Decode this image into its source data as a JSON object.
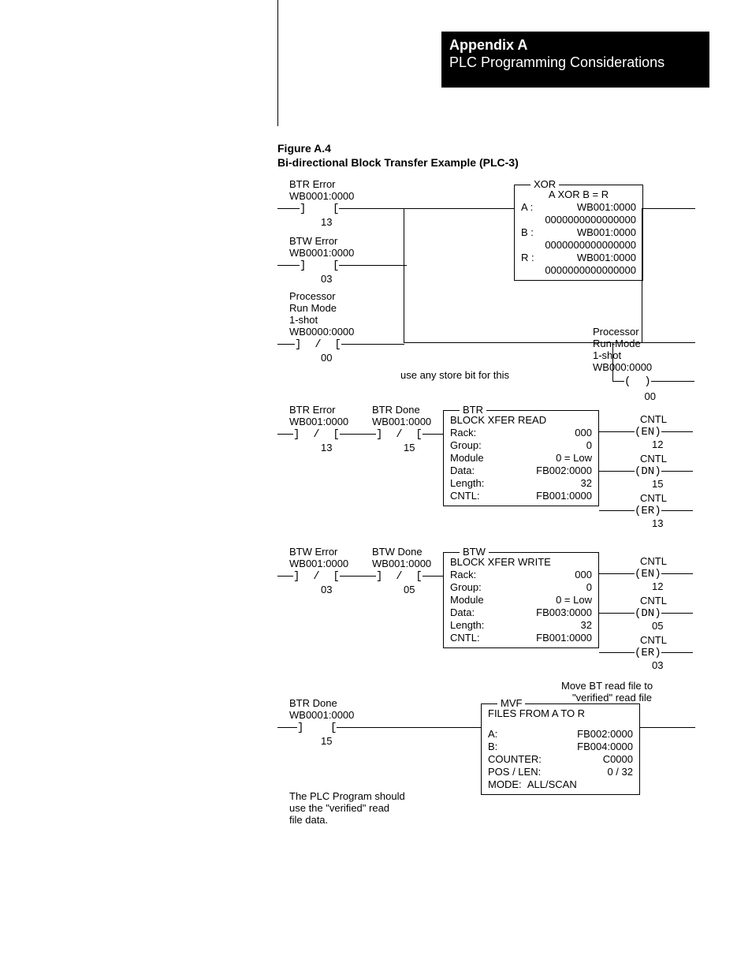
{
  "header": {
    "appendix": "Appendix A",
    "subtitle": "PLC Programming Considerations"
  },
  "figure": {
    "label": "Figure A.4",
    "caption": "Bi-directional Block Transfer Example (PLC-3)"
  },
  "rung1": {
    "btr_error_lbl": "BTR Error",
    "btr_error_addr": "WB0001:0000",
    "btr_error_bit": "13",
    "btw_error_lbl": "BTW Error",
    "btw_error_addr": "WB0001:0000",
    "btw_error_bit": "03",
    "proc_lbl1": "Processor",
    "proc_lbl2": "Run Mode",
    "proc_lbl3": "1-shot",
    "proc_addr": "WB0000:0000",
    "proc_bit": "00",
    "note": "use any store bit for this",
    "xor_title": "XOR",
    "xor_eq": "A XOR B = R",
    "xor_a_lbl": "A   :",
    "xor_a_val": "WB001:0000",
    "xor_a_data": "0000000000000000",
    "xor_b_lbl": "B   :",
    "xor_b_val": "WB001:0000",
    "xor_b_data": "0000000000000000",
    "xor_r_lbl": "R   :",
    "xor_r_val": "WB001:0000",
    "xor_r_data": "0000000000000000",
    "out_lbl1": "Processor",
    "out_lbl2": "Run-Mode",
    "out_lbl3": "1-shot",
    "out_addr": "WB000:0000",
    "out_bit": "00"
  },
  "rung2": {
    "btr_error_lbl": "BTR Error",
    "btr_error_addr": "WB001:0000",
    "btr_error_bit": "13",
    "btr_done_lbl": "BTR Done",
    "btr_done_addr": "WB001:0000",
    "btr_done_bit": "15",
    "box_title": "BTR",
    "box_heading": "BLOCK XFER READ",
    "rack_lbl": "Rack:",
    "rack_val": "000",
    "group_lbl": "Group:",
    "group_val": "0",
    "module_lbl": "Module",
    "module_val": "0 = Low",
    "data_lbl": "Data:",
    "data_val": "FB002:0000",
    "length_lbl": "Length:",
    "length_val": "32",
    "cntl_lbl": "CNTL:",
    "cntl_val": "FB001:0000",
    "en_lbl": "CNTL",
    "en_sub": "(EN)",
    "en_bit": "12",
    "dn_lbl": "CNTL",
    "dn_sub": "(DN)",
    "dn_bit": "15",
    "er_lbl": "CNTL",
    "er_sub": "(ER)",
    "er_bit": "13"
  },
  "rung3": {
    "btw_error_lbl": "BTW Error",
    "btw_error_addr": "WB001:0000",
    "btw_error_bit": "03",
    "btw_done_lbl": "BTW Done",
    "btw_done_addr": "WB001:0000",
    "btw_done_bit": "05",
    "box_title": "BTW",
    "box_heading": "BLOCK XFER WRITE",
    "rack_lbl": "Rack:",
    "rack_val": "000",
    "group_lbl": "Group:",
    "group_val": "0",
    "module_lbl": "Module",
    "module_val": "0 = Low",
    "data_lbl": "Data:",
    "data_val": "FB003:0000",
    "length_lbl": "Length:",
    "length_val": "32",
    "cntl_lbl": "CNTL:",
    "cntl_val": "FB001:0000",
    "en_lbl": "CNTL",
    "en_sub": "(EN)",
    "en_bit": "12",
    "dn_lbl": "CNTL",
    "dn_sub": "(DN)",
    "dn_bit": "05",
    "er_lbl": "CNTL",
    "er_sub": "(ER)",
    "er_bit": "03"
  },
  "rung4": {
    "note1": "Move BT read file to",
    "note2": "\"verified\" read file",
    "btr_done_lbl": "BTR Done",
    "btr_done_addr": "WB0001:0000",
    "btr_done_bit": "15",
    "box_title": "MVF",
    "box_heading": "FILES FROM A TO R",
    "a_lbl": "A:",
    "a_val": "FB002:0000",
    "b_lbl": "B:",
    "b_val": "FB004:0000",
    "counter_lbl": "COUNTER:",
    "counter_val": "C0000",
    "poslen_lbl": "POS / LEN:",
    "poslen_val": "0 / 32",
    "mode_lbl": "MODE:",
    "mode_val": "ALL/SCAN",
    "footnote1": "The PLC Program should",
    "footnote2": "use the \"verified\" read",
    "footnote3": "file data."
  }
}
